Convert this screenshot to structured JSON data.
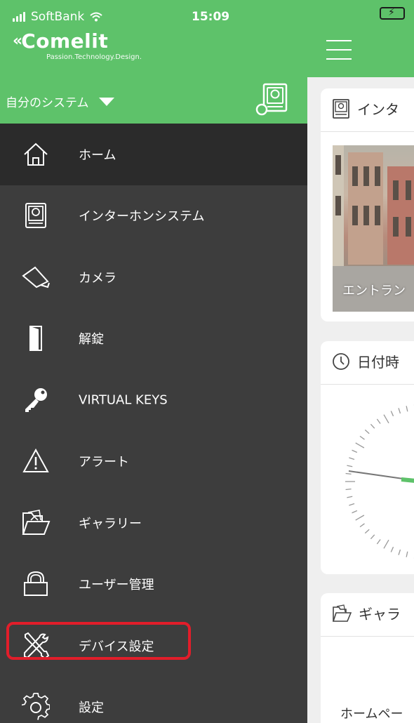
{
  "status_bar": {
    "carrier": "SoftBank",
    "time": "15:09"
  },
  "brand": {
    "name": "Comelit",
    "tagline": "Passion.Technology.Design."
  },
  "system_selector": {
    "label": "自分のシステム"
  },
  "menu": {
    "items": [
      {
        "label": "ホーム",
        "icon": "home-icon",
        "active": true
      },
      {
        "label": "インターホンシステム",
        "icon": "intercom-icon",
        "active": false
      },
      {
        "label": "カメラ",
        "icon": "camera-icon",
        "active": false
      },
      {
        "label": "解錠",
        "icon": "door-icon",
        "active": false
      },
      {
        "label": "VIRTUAL KEYS",
        "icon": "key-icon",
        "active": false
      },
      {
        "label": "アラート",
        "icon": "alert-icon",
        "active": false
      },
      {
        "label": "ギャラリー",
        "icon": "gallery-folder-icon",
        "active": false
      },
      {
        "label": "ユーザー管理",
        "icon": "lock-icon",
        "active": false
      },
      {
        "label": "デバイス設定",
        "icon": "tools-icon",
        "active": false,
        "highlighted": true
      },
      {
        "label": "設定",
        "icon": "gear-icon",
        "active": false
      }
    ]
  },
  "main": {
    "cards": {
      "intercom": {
        "title": "インタ",
        "photo_caption": "エントラン"
      },
      "datetime": {
        "title": "日付時"
      },
      "gallery": {
        "title": "ギャラ",
        "body": "ホームペー"
      }
    }
  },
  "colors": {
    "brand_green": "#5ec26a",
    "drawer_bg": "#3d3d3d",
    "drawer_active": "#2b2b2b",
    "highlight_red": "#e21d2a",
    "main_bg": "#efefef"
  }
}
